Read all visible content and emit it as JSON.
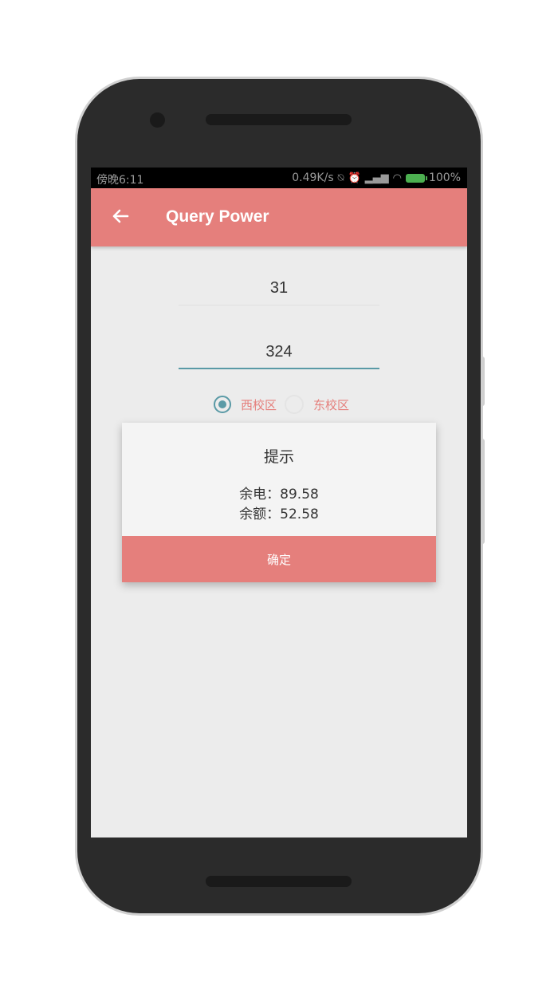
{
  "status_bar": {
    "time": "傍晚6:11",
    "network_speed": "0.49K/s",
    "battery": "100%",
    "icons": [
      "alarm-off-icon",
      "alarm-clock-icon",
      "signal-icon",
      "wifi-icon",
      "battery-charging-icon"
    ]
  },
  "app_bar": {
    "title": "Query Power",
    "back_icon": "arrow-left-icon"
  },
  "form": {
    "field1_value": "31",
    "field2_value": "324",
    "radio_options": [
      {
        "label": "西校区",
        "checked": true
      },
      {
        "label": "东校区",
        "checked": false
      }
    ]
  },
  "dialog": {
    "title": "提示",
    "line1": "余电：89.58",
    "line2": "余额：52.58",
    "confirm_label": "确定"
  },
  "colors": {
    "accent": "#e57f7c",
    "teal": "#5a9aa6",
    "background": "#ececec"
  }
}
